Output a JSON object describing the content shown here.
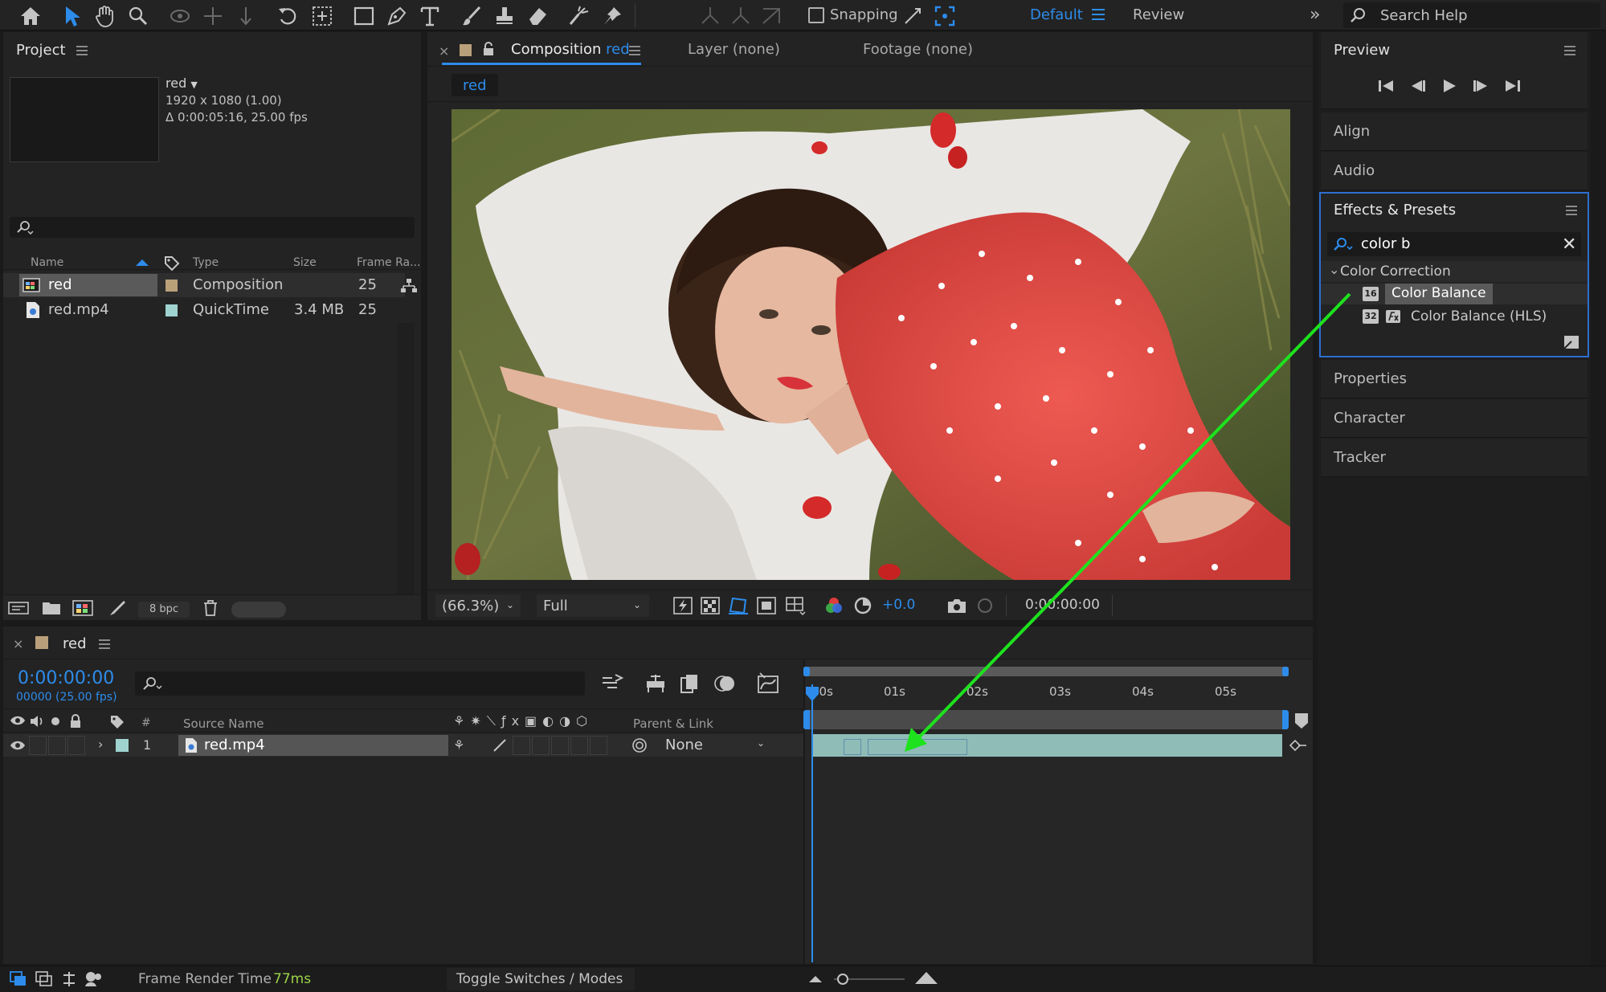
{
  "toolbar": {
    "snapping_label": "Snapping",
    "workspace_default": "Default",
    "workspace_review": "Review",
    "search_placeholder": "Search Help"
  },
  "project": {
    "title": "Project",
    "selected_name": "red",
    "selected_dims": "1920 x 1080 (1.00)",
    "selected_duration": "Δ 0:00:05:16, 25.00 fps",
    "columns": {
      "name": "Name",
      "type": "Type",
      "size": "Size",
      "frame_rate": "Frame Ra..."
    },
    "items": [
      {
        "name": "red",
        "type": "Composition",
        "size": "",
        "fps": "25",
        "label_color": "#b9a07a"
      },
      {
        "name": "red.mp4",
        "type": "QuickTime",
        "size": "3.4 MB",
        "fps": "25",
        "label_color": "#9fd3d0"
      }
    ],
    "bpc": "8 bpc"
  },
  "viewer": {
    "tab_composition_prefix": "Composition",
    "tab_composition_name": "red",
    "tab_layer": "Layer (none)",
    "tab_footage": "Footage (none)",
    "breadcrumb": "red",
    "zoom": "(66.3%)",
    "resolution": "Full",
    "exposure": "+0.0",
    "timecode": "0:00:00:00"
  },
  "right_panel": {
    "preview": "Preview",
    "align": "Align",
    "audio": "Audio",
    "effects_title": "Effects & Presets",
    "effects_search": "color b",
    "category": "Color Correction",
    "effect1_badge": "16",
    "effect1": "Color Balance",
    "effect2_badge": "32",
    "effect2": "Color Balance (HLS)",
    "properties": "Properties",
    "character": "Character",
    "tracker": "Tracker"
  },
  "timeline": {
    "comp_name": "red",
    "timecode": "0:00:00:00",
    "frames_fps": "00000 (25.00 fps)",
    "col_hash": "#",
    "col_source": "Source Name",
    "col_parent": "Parent & Link",
    "layer_number": "1",
    "layer_name": "red.mp4",
    "parent_value": "None",
    "ruler": [
      "00s",
      "01s",
      "02s",
      "03s",
      "04s",
      "05s"
    ]
  },
  "status": {
    "frame_render_label": "Frame Render Time",
    "frame_render_value": "77ms",
    "toggle_label": "Toggle Switches / Modes"
  },
  "colors": {
    "accent_blue": "#2d8ceb",
    "annotation_green": "#1de21d",
    "layer_teal": "#8fbcb7",
    "dress_red": "#e24a44"
  }
}
